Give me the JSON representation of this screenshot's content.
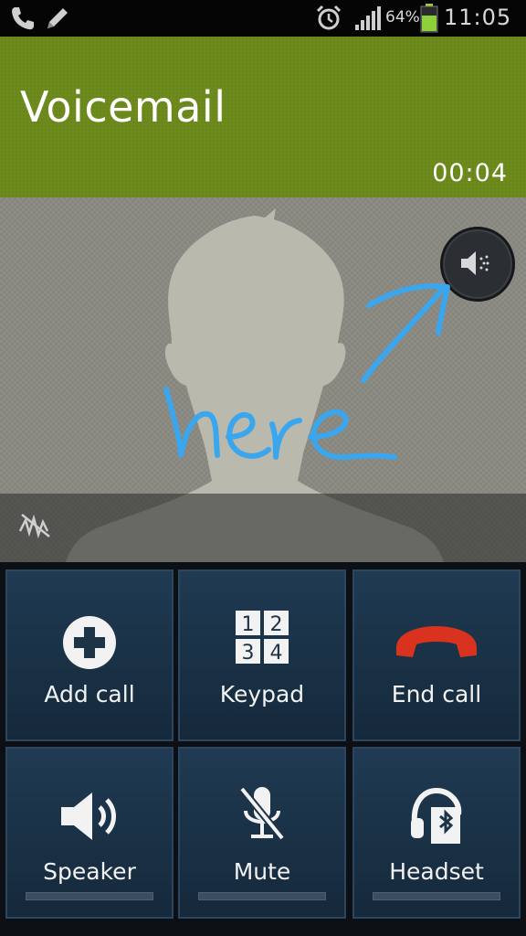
{
  "status_bar": {
    "battery_percent": "64%",
    "battery_level": 0.64,
    "time": "11:05",
    "icons": [
      "phone-icon",
      "pencil-icon",
      "alarm-icon",
      "signal-icon",
      "battery-icon"
    ]
  },
  "call": {
    "caller_name": "Voicemail",
    "timer": "00:04"
  },
  "annotation": {
    "handwritten_text": "here"
  },
  "controls": {
    "add_call": "Add call",
    "keypad": "Keypad",
    "keypad_digits": [
      "1",
      "2",
      "3",
      "4"
    ],
    "end_call": "End call",
    "speaker": "Speaker",
    "mute": "Mute",
    "headset": "Headset"
  },
  "colors": {
    "header_green": "#6d8a1c",
    "button_blue": "#1f3a52",
    "end_call_red": "#d9321e",
    "annotation_blue": "#3aa6ee"
  }
}
